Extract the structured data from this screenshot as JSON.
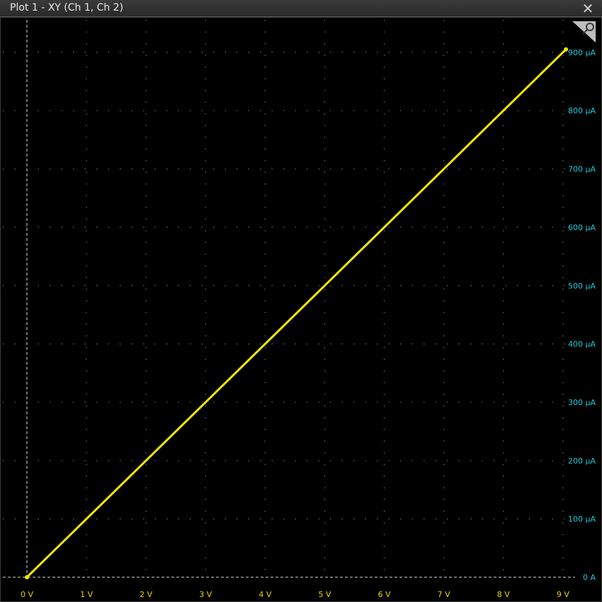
{
  "window": {
    "title": "Plot 1 - XY (Ch 1, Ch 2)",
    "close_icon": "close-icon",
    "zoom_icon": "magnifier-icon"
  },
  "colors": {
    "trace": "#f2e600",
    "x_tick_label": "#e6d600",
    "y_tick_label": "#20c8d8",
    "grid": "#6a6a6a",
    "background": "#000000"
  },
  "chart_data": {
    "type": "line",
    "xlim": [
      0,
      9
    ],
    "ylim": [
      0,
      900
    ],
    "grid": true,
    "x_ticks": [
      0,
      1,
      2,
      3,
      4,
      5,
      6,
      7,
      8,
      9
    ],
    "y_ticks": [
      0,
      100,
      200,
      300,
      400,
      500,
      600,
      700,
      800,
      900
    ],
    "x_tick_labels": [
      "0 V",
      "1 V",
      "2 V",
      "3 V",
      "4 V",
      "5 V",
      "6 V",
      "7 V",
      "8 V",
      "9 V"
    ],
    "y_tick_labels": [
      "0 A",
      "100 µA",
      "200 µA",
      "300 µA",
      "400 µA",
      "500 µA",
      "600 µA",
      "700 µA",
      "800 µA",
      "900 µA"
    ],
    "series": [
      {
        "x": [
          0,
          9.05
        ],
        "y": [
          0,
          905
        ]
      }
    ]
  }
}
